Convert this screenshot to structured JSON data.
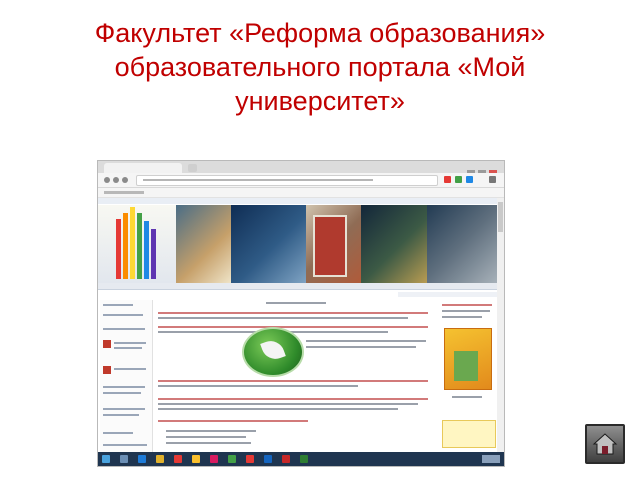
{
  "slide": {
    "title": "Факультет «Реформа образования» образовательного портала «Мой университет»"
  },
  "colors": {
    "title": "#c00000",
    "taskbar": "#1f3550",
    "home_button": "#5a5a5a"
  },
  "icons": {
    "home_button": "home-icon"
  }
}
